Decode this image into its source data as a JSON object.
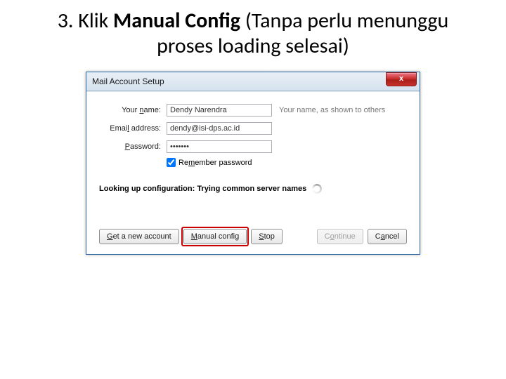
{
  "slide": {
    "title_prefix": "3. Klik ",
    "title_bold": "Manual Config",
    "title_suffix": " (Tanpa perlu menunggu proses loading selesai)"
  },
  "dialog": {
    "title": "Mail Account Setup",
    "close": "x",
    "labels": {
      "name": "Your name:",
      "email": "Email address:",
      "password": "Password:"
    },
    "values": {
      "name": "Dendy Narendra",
      "email": "dendy@isi-dps.ac.id",
      "password": "•••••••"
    },
    "hints": {
      "name": "Your name, as shown to others"
    },
    "remember": {
      "checked": true,
      "label": "Remember password"
    },
    "status": {
      "prefix": "Looking up configuration: ",
      "detail": "Trying common server names"
    },
    "buttons": {
      "new_account": "Get a new account",
      "manual": "Manual config",
      "stop": "Stop",
      "continue": "Continue",
      "cancel": "Cancel"
    }
  }
}
